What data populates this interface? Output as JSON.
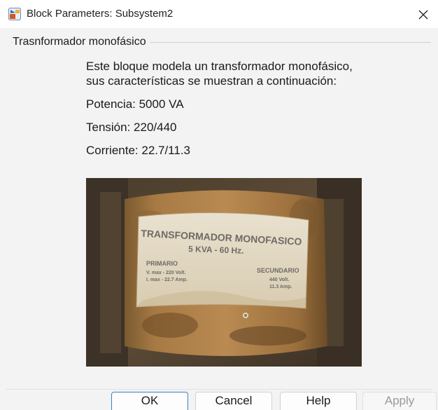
{
  "window": {
    "title": "Block Parameters: Subsystem2",
    "close_glyph": "✕"
  },
  "group": {
    "title": "Trasnformador monofásico"
  },
  "description": "Este bloque modela un transformador monofásico, sus características se muestran a continuación:",
  "specs": [
    "Potencia: 5000 VA",
    "Tensión: 220/440",
    "Corriente: 22.7/11.3"
  ],
  "photo": {
    "label_lines": {
      "heading": "TRANSFORMADOR MONOFASICO",
      "rating": "5 KVA - 60 Hz.",
      "primary_title": "PRIMARIO",
      "primary_v": "V. max - 220 Volt.",
      "primary_i": "I. max - 22.7 Amp.",
      "secondary_title": "SECUNDARIO",
      "secondary_v": "440 Volt.",
      "secondary_i": "11.3 Amp."
    }
  },
  "buttons": {
    "ok": "OK",
    "cancel": "Cancel",
    "help": "Help",
    "apply": "Apply"
  },
  "icons": {
    "app": "simulink-block-icon",
    "close": "close-icon"
  }
}
